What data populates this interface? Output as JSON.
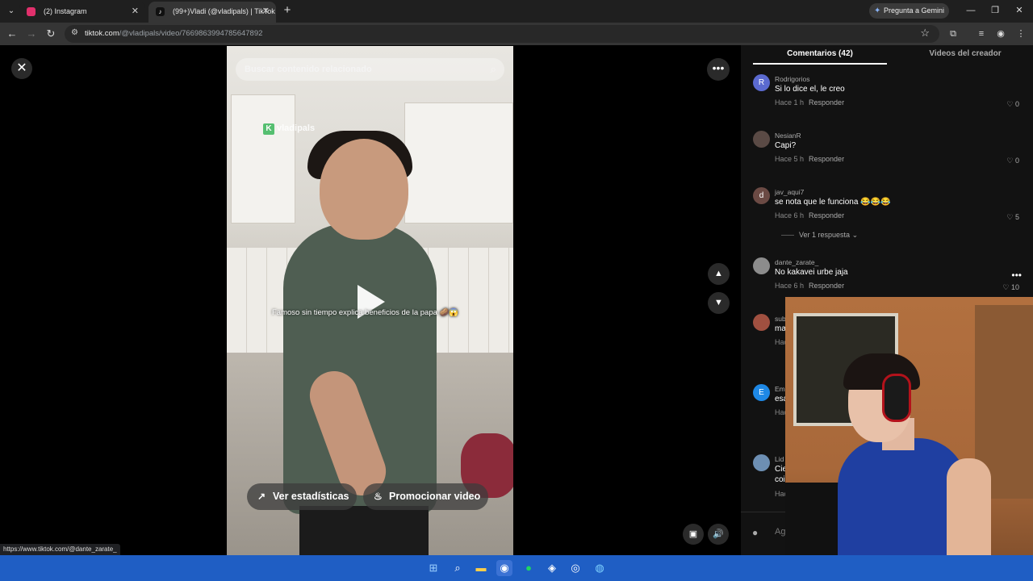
{
  "browser": {
    "tabs": [
      {
        "title": "(2) Instagram",
        "favicon_color": "#e1306c",
        "active": false
      },
      {
        "title": "(99+)Vladi (@vladipals) | TikTok",
        "favicon_color": "#111111",
        "active": true
      }
    ],
    "new_tab_label": "+",
    "gemini_label": "Pregunta a Gemini",
    "url_domain": "tiktok.com",
    "url_path": "/@vladipals/video/7669863994785647892"
  },
  "video": {
    "search_placeholder": "Buscar contenido relacionado",
    "watermark": "vladipals",
    "watermark_badge": "K",
    "caption": "Famoso sin tiempo explica beneficios de la papa 🥔😱",
    "stats_button": "Ver estadísticas",
    "promote_button": "Promocionar video"
  },
  "panel": {
    "tab_comments": "Comentarios (42)",
    "tab_creator_videos": "Videos del creador",
    "reply_label": "Responder",
    "comments": [
      {
        "user": "Rodrigorios",
        "avatar_letter": "R",
        "avatar_color": "#5b6ad0",
        "text": "Si lo dice el, le creo",
        "time": "Hace 1 h",
        "likes": "0"
      },
      {
        "user": "NesianR",
        "avatar_letter": "",
        "avatar_color": "#5a4a45",
        "text": "Capi?",
        "time": "Hace 5 h",
        "likes": "0"
      },
      {
        "user": "jav_aqui7",
        "avatar_letter": "d",
        "avatar_color": "#6b4a44",
        "text": "se nota que le funciona 😂😂😂",
        "time": "Hace 6 h",
        "likes": "5",
        "replies": "Ver 1 respuesta"
      },
      {
        "user": "dante_zarate_",
        "avatar_letter": "",
        "avatar_color": "#8c8c8c",
        "text": "No kakavei urbe jaja",
        "time": "Hace 6 h",
        "likes": "10"
      },
      {
        "user": "sub",
        "avatar_letter": "",
        "avatar_color": "#a05040",
        "text": "ma",
        "time": "Hac",
        "likes": ""
      },
      {
        "user": "Ema",
        "avatar_letter": "E",
        "avatar_color": "#1e88e5",
        "text": "esa",
        "time": "Hac",
        "likes": ""
      },
      {
        "user": "Lid",
        "avatar_letter": "",
        "avatar_color": "#6d8fb3",
        "text": "Cie",
        "text2": "coi",
        "time": "Hac",
        "likes": ""
      }
    ],
    "add_comment_placeholder": "Ag"
  },
  "status_url": "https://www.tiktok.com/@dante_zarate_",
  "taskbar": {
    "icons": [
      "windows-icon",
      "search-icon",
      "file-explorer-icon",
      "chrome-icon",
      "spotify-icon",
      "app-icon",
      "obs-icon",
      "browser-icon"
    ]
  }
}
